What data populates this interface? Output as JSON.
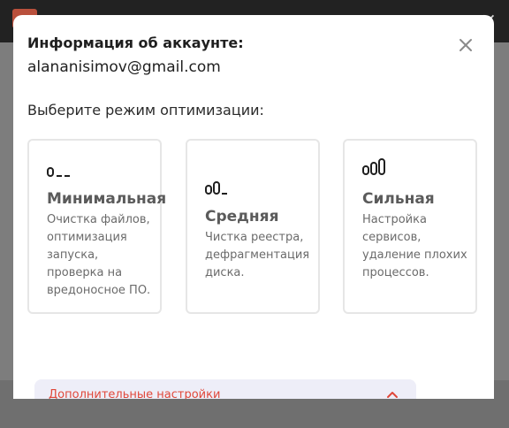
{
  "modal": {
    "account_title": "Информация об аккаунте:",
    "account_email": "alananisimov@gmail.com",
    "section_label": "Выберите режим оптимизации:",
    "modes": [
      {
        "icon": "level-low-icon",
        "title": "Минимальная",
        "description": "Очистка файлов, оптимизация запуска, проверка на вредоносное ПО."
      },
      {
        "icon": "level-medium-icon",
        "title": "Средняя",
        "description": "Чистка реестра, дефрагментация диска."
      },
      {
        "icon": "level-high-icon",
        "title": "Сильная",
        "description": "Настройка сервисов, удаление плохих процессов."
      }
    ],
    "advanced_label": "Дополнительные настройки",
    "accent_color": "#e0483a"
  }
}
